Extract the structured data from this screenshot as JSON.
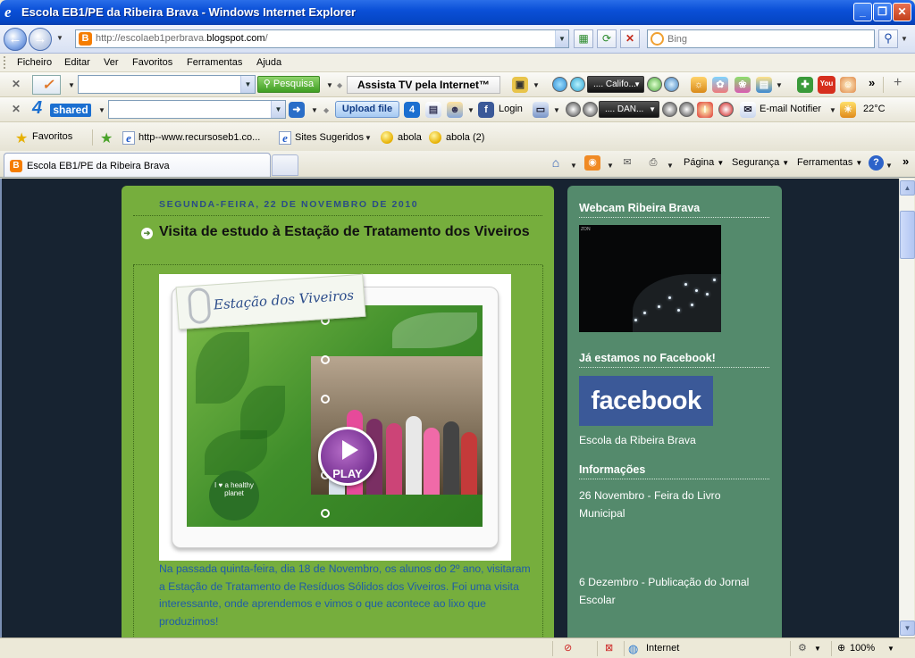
{
  "window": {
    "title": "Escola EB1/PE da Ribeira Brava - Windows Internet Explorer",
    "minimize": "_",
    "maximize": "❐",
    "close": "✕"
  },
  "address": {
    "url_prefix": "http://escolaeb1perbrava.",
    "url_domain": "blogspot.com",
    "url_suffix": "/",
    "search_placeholder": "Bing"
  },
  "menu": [
    "Ficheiro",
    "Editar",
    "Ver",
    "Favoritos",
    "Ferramentas",
    "Ajuda"
  ],
  "toolbar1": {
    "search_button": "Pesquisa",
    "tv_label": "Assista TV pela Internet™",
    "radio_station": ".... Califo..."
  },
  "toolbar2": {
    "upload_label": "Upload file",
    "shared_logo": "shared",
    "login_label": "Login",
    "radio_station": ".... DAN...",
    "email_label": "E-mail Notifier",
    "weather_label": "22°C"
  },
  "favorites": {
    "favorites_label": "Favoritos",
    "items": [
      "http--www.recursoseb1.co...",
      "Sites Sugeridos",
      "abola",
      "abola (2)"
    ]
  },
  "tab": {
    "label": "Escola EB1/PE da Ribeira Brava"
  },
  "commands": {
    "pagina": "Página",
    "seguranca": "Segurança",
    "ferramentas": "Ferramentas"
  },
  "post": {
    "date": "SEGUNDA-FEIRA, 22 DE NOVEMBRO DE 2010",
    "title": "Visita de estudo à Estação de Tratamento dos Viveiros",
    "video_tag": "Estação dos Viveiros",
    "play_label": "PLAY",
    "healthy_badge": "I ♥ a healthy planet",
    "body": "Na passada quinta-feira, dia 18 de Novembro, os alunos do 2º ano, visitaram a Estação de Tratamento de Resíduos Sólidos dos Viveiros. Foi uma visita interessante, onde aprendemos e vimos o que acontece ao lixo que produzimos!"
  },
  "sidebar": {
    "webcam_title": "Webcam Ribeira Brava",
    "facebook_title": "Já estamos no Facebook!",
    "facebook_logo": "facebook",
    "facebook_link": "Escola da Ribeira Brava",
    "info_title": "Informações",
    "info_items": [
      "26 Novembro - Feira do Livro Municipal",
      "6 Dezembro - Publicação do Jornal Escolar"
    ]
  },
  "status": {
    "zone": "Internet",
    "zoom": "100%"
  },
  "colors": {
    "page_background": "#172331",
    "main_column": "#76ae3d",
    "sidebar_column": "#548a6c",
    "link_blue": "#1f5ca8",
    "facebook_blue": "#3b5998"
  }
}
